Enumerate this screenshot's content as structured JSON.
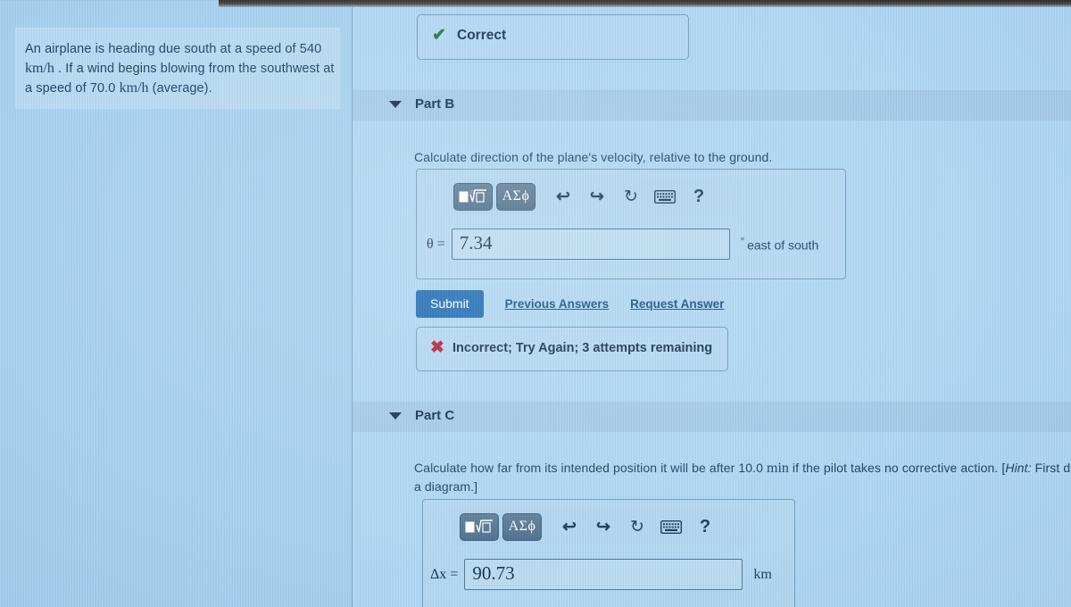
{
  "problem": {
    "text_parts": [
      {
        "t": "An airplane is heading due south at a speed of 540 ",
        "style": "normal"
      },
      {
        "t": "km/h",
        "style": "math"
      },
      {
        "t": " . If a wind begins blowing from the southwest at a speed of 70.0 ",
        "style": "normal"
      },
      {
        "t": "km/h",
        "style": "math"
      },
      {
        "t": " (average).",
        "style": "normal"
      }
    ],
    "speed_plane": "540",
    "speed_plane_unit": "km/h",
    "speed_wind": "70.0",
    "speed_wind_unit": "km/h",
    "line1": "An airplane is heading due south at a speed of 540",
    "line2_pre": ". If a wind begins blowing from the southwest at",
    "line3": "a speed of 70.0",
    "line3_post": "(average)."
  },
  "correct_banner": {
    "icon": "check-icon",
    "label": "Correct"
  },
  "part_b": {
    "caret": "chevron-down-icon",
    "title": "Part B",
    "question": "Calculate direction of the plane's velocity, relative to the ground.",
    "toolbar": {
      "template_button": "math-template-icon",
      "greek_button": "ΑΣϕ",
      "undo": "undo-icon",
      "redo": "redo-icon",
      "reset": "reset-icon",
      "keyboard": "keyboard-icon",
      "help": "?"
    },
    "answer": {
      "variable": "θ =",
      "value": "7.34",
      "placeholder": "",
      "degree_symbol": "°",
      "unit": "east of south"
    },
    "submit_label": "Submit",
    "previous_answers_label": "Previous Answers",
    "request_answer_label": "Request Answer",
    "feedback": {
      "icon": "x-icon",
      "label": "Incorrect; Try Again; 3 attempts remaining",
      "attempts_remaining": "3"
    }
  },
  "part_c": {
    "caret": "chevron-down-icon",
    "title": "Part C",
    "question_line1_a": "Calculate how far from its intended position it will be after 10.0",
    "question_unit": "min",
    "question_line1_b": "if the pilot takes no corrective action. [",
    "hint_word": "Hint:",
    "question_line1_c": " First draw a",
    "question_line2": "diagram.]",
    "toolbar": {
      "template_button": "math-template-icon",
      "greek_button": "ΑΣϕ",
      "undo": "undo-icon",
      "redo": "redo-icon",
      "reset": "reset-icon",
      "keyboard": "keyboard-icon",
      "help": "?"
    },
    "answer": {
      "variable": "Δx =",
      "value": "90.73",
      "placeholder": "",
      "unit": "km"
    }
  },
  "colors": {
    "page_background": "#a9d2ef",
    "panel_background": "#aed6f2",
    "problem_box": "#b6d9f2",
    "submit_blue": "#1d6cb4",
    "link_blue": "#134e80",
    "correct_green": "#1f7a3d",
    "incorrect_red": "#b11f2e",
    "text_navy": "#12304c",
    "toolbar_button": "#4b6e8c"
  }
}
